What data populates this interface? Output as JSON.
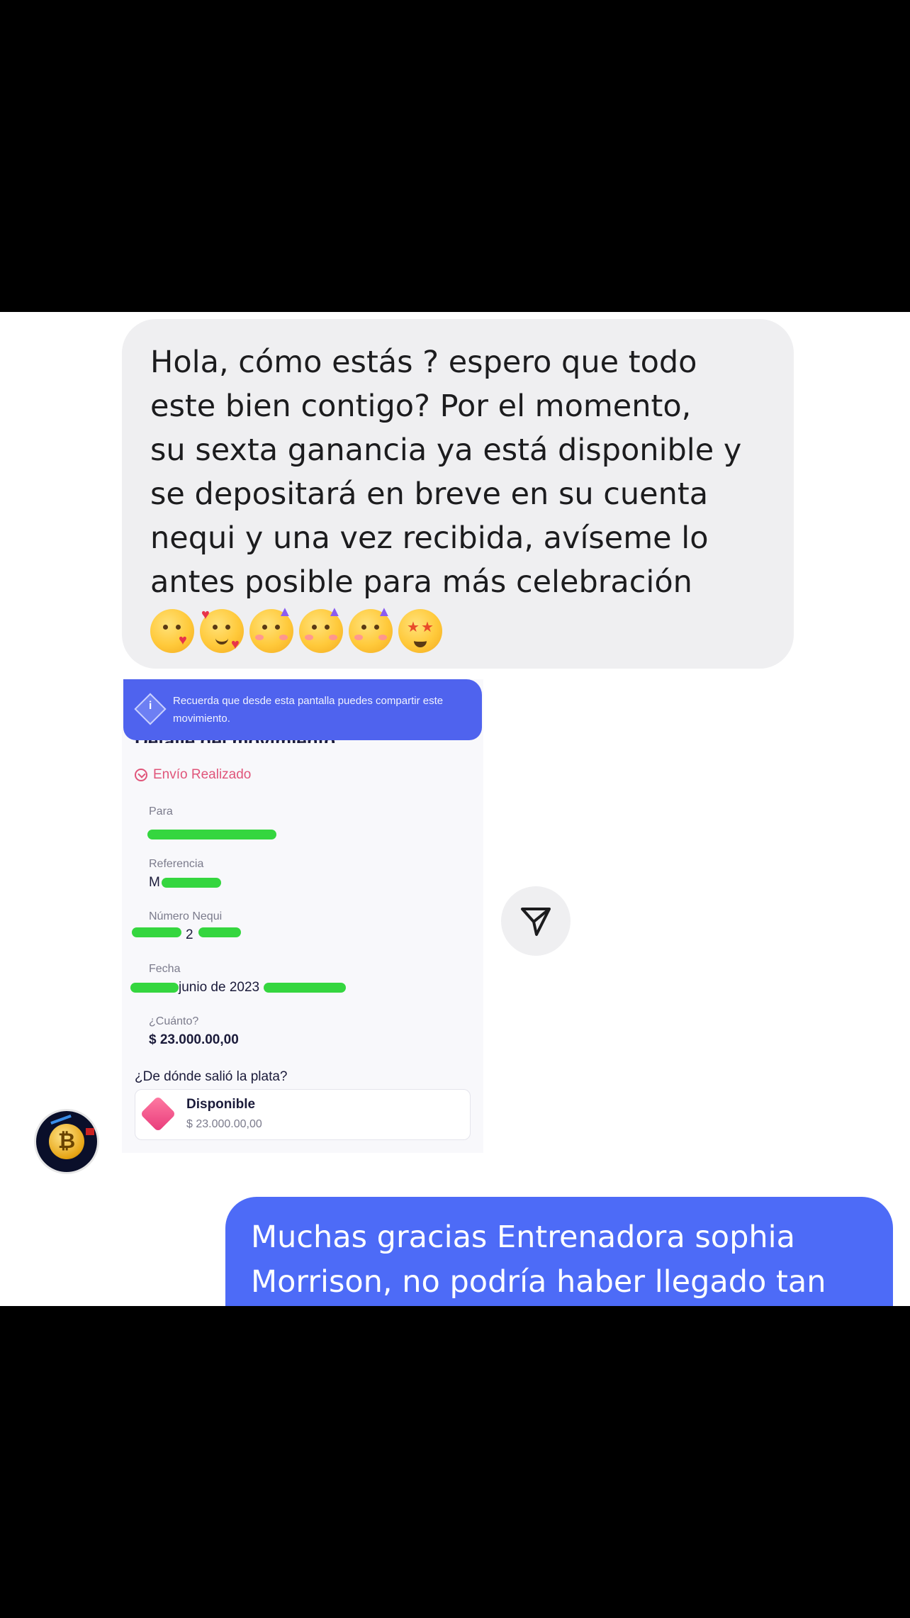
{
  "incoming_message": {
    "text": "Hola, cómo estás ?  espero que todo\neste bien contigo?  Por el momento,\nsu sexta ganancia ya está disponible y\nse depositará en breve en su cuenta\nnequi y una vez recibida, avíseme lo\nantes posible para más celebración",
    "emojis": [
      "kissing-heart-emoji",
      "smiling-hearts-emoji",
      "partying-face-emoji",
      "partying-face-emoji",
      "partying-face-emoji",
      "star-struck-emoji"
    ]
  },
  "shared_screenshot": {
    "banner_text": "Recuerda que desde esta pantalla puedes compartir este movimiento.",
    "title": "Detalle del movimiento",
    "status": "Envío Realizado",
    "fields": [
      {
        "label": "Para",
        "value": ""
      },
      {
        "label": "Referencia",
        "value": "M"
      },
      {
        "label": "Número Nequi",
        "value": "2"
      },
      {
        "label": "Fecha",
        "value": "junio de 2023"
      },
      {
        "label": "¿Cuánto?",
        "value": "$ 23.000.00,00"
      }
    ],
    "source_question": "¿De dónde salió la plata?",
    "source_name": "Disponible",
    "source_amount": "$ 23.000.00,00",
    "accent_color": "#4f63ee",
    "redaction_color": "#35d63f"
  },
  "outgoing_message": {
    "text": "Muchas gracias Entrenadora sophia\nMorrison, no podría haber llegado tan"
  },
  "colors": {
    "incoming_bubble": "#efeff1",
    "outgoing_bubble": "#4d6bf7"
  }
}
